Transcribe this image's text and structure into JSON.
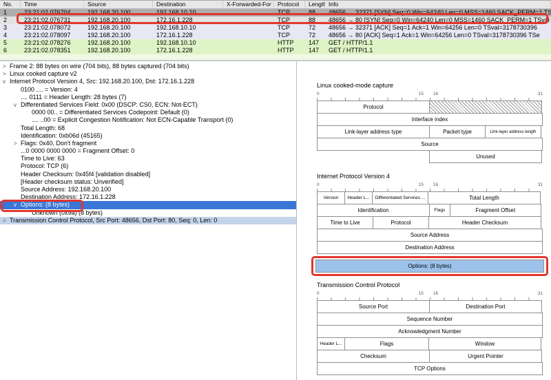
{
  "packet_list": {
    "columns": [
      {
        "label": "No."
      },
      {
        "label": "Time"
      },
      {
        "label": "Source"
      },
      {
        "label": "Destination"
      },
      {
        "label": "X-Forwarded-For"
      },
      {
        "label": "Protocol"
      },
      {
        "label": "Length"
      },
      {
        "label": "Info"
      }
    ],
    "rows": [
      {
        "no": "1",
        "time": "23:21:02.076704",
        "source": "192.168.20.100",
        "destination": "192.168.10.10",
        "x_forwarded_for": "",
        "protocol": "TCP",
        "length": "88",
        "info": "48656 → 32371 [SYN] Seq=0 Win=64240 Len=0 MSS=1460 SACK_PERM=1 TS"
      },
      {
        "no": "2",
        "time": "23:21:02.076731",
        "source": "192.168.20.100",
        "destination": "172.16.1.228",
        "x_forwarded_for": "",
        "protocol": "TCP",
        "length": "88",
        "info": "48656 → 80 [SYN] Seq=0 Win=64240 Len=0 MSS=1460 SACK_PERM=1 TSval"
      },
      {
        "no": "3",
        "time": "23:21:02.078072",
        "source": "192.168.20.100",
        "destination": "192.168.10.10",
        "x_forwarded_for": "",
        "protocol": "TCP",
        "length": "72",
        "info": "48656 → 32371 [ACK] Seq=1 Ack=1 Win=64256 Len=0 TSval=3178730396"
      },
      {
        "no": "4",
        "time": "23:21:02.078097",
        "source": "192.168.20.100",
        "destination": "172.16.1.228",
        "x_forwarded_for": "",
        "protocol": "TCP",
        "length": "72",
        "info": "48656 → 80 [ACK] Seq=1 Ack=1 Win=64256 Len=0 TSval=3178730396 TSe"
      },
      {
        "no": "5",
        "time": "23:21:02.078276",
        "source": "192.168.20.100",
        "destination": "192.168.10.10",
        "x_forwarded_for": "",
        "protocol": "HTTP",
        "length": "147",
        "info": "GET / HTTP/1.1"
      },
      {
        "no": "6",
        "time": "23:21:02.078351",
        "source": "192.168.20.100",
        "destination": "172.16.1.228",
        "x_forwarded_for": "",
        "protocol": "HTTP",
        "length": "147",
        "info": "GET / HTTP/1.1"
      }
    ]
  },
  "icons": {
    "collapsed": ">",
    "expanded": "v"
  },
  "details": {
    "lines": [
      {
        "text": "Frame 2: 88 bytes on wire (704 bits), 88 bytes captured (704 bits)"
      },
      {
        "text": "Linux cooked capture v2"
      },
      {
        "text": "Internet Protocol Version 4, Src: 192.168.20.100, Dst: 172.16.1.228"
      },
      {
        "text": "0100 .... = Version: 4"
      },
      {
        "text": ".... 0111 = Header Length: 28 bytes (7)"
      },
      {
        "text": "Differentiated Services Field: 0x00 (DSCP: CS0, ECN: Not-ECT)"
      },
      {
        "text": "0000 00.. = Differentiated Services Codepoint: Default (0)"
      },
      {
        "text": ".... ..00 = Explicit Congestion Notification: Not ECN-Capable Transport (0)"
      },
      {
        "text": "Total Length: 68"
      },
      {
        "text": "Identification: 0xb06d (45165)"
      },
      {
        "text": "Flags: 0x40, Don't fragment"
      },
      {
        "text": "...0 0000 0000 0000 = Fragment Offset: 0"
      },
      {
        "text": "Time to Live: 63"
      },
      {
        "text": "Protocol: TCP (6)"
      },
      {
        "text": "Header Checksum: 0x45f4 [validation disabled]"
      },
      {
        "text": "[Header checksum status: Unverified]"
      },
      {
        "text": "Source Address: 192.168.20.100"
      },
      {
        "text": "Destination Address: 172.16.1.228"
      },
      {
        "text": "Options: (8 bytes)"
      },
      {
        "text": "Unknown (0x9a) (8 bytes)"
      },
      {
        "text": "Transmission Control Protocol, Src Port: 48656, Dst Port: 80, Seq: 0, Len: 0"
      }
    ]
  },
  "diagrams": {
    "ruler": {
      "l0": "0",
      "l15": "15",
      "l16": "16",
      "l31": "31"
    },
    "sll": {
      "title": "Linux cooked-mode capture",
      "cells": {
        "protocol": "Protocol",
        "interface_index": "Interface index",
        "lladdr_type": "Link-layer address type",
        "packet_type": "Packet type",
        "lladdr_len": "Link-layer address length",
        "source": "Source",
        "unused": "Unused"
      }
    },
    "ipv4": {
      "title": "Internet Protocol Version 4",
      "cells": {
        "version": "Version",
        "header_len": "Header L...",
        "dsf": "Differentiated Services ...",
        "total_length": "Total Length",
        "identification": "Identification",
        "flags": "Flags",
        "fragment_offset": "Fragment Offset",
        "ttl": "Time to Live",
        "protocol": "Protocol",
        "header_checksum": "Header Checksum",
        "source_address": "Source Address",
        "destination_address": "Destination Address",
        "options": "Options: (8 bytes)"
      }
    },
    "tcp": {
      "title": "Transmission Control Protocol",
      "cells": {
        "source_port": "Source Port",
        "destination_port": "Destination Port",
        "sequence_number": "Sequence Number",
        "ack_number": "Acknowledgment Number",
        "header_len": "Header L...",
        "flags": "Flags",
        "window": "Window",
        "checksum": "Checksum",
        "urgent_pointer": "Urgent Pointer",
        "tcp_options": "TCP Options"
      }
    }
  },
  "colors": {
    "selection_blue": "#3a76d6",
    "related_blue": "#c3d4ea",
    "diagram_highlight": "#9cc2ec",
    "annotation_red": "#e0372e",
    "http_row": "#def3c6",
    "tcp_row": "#e8e7f4"
  }
}
